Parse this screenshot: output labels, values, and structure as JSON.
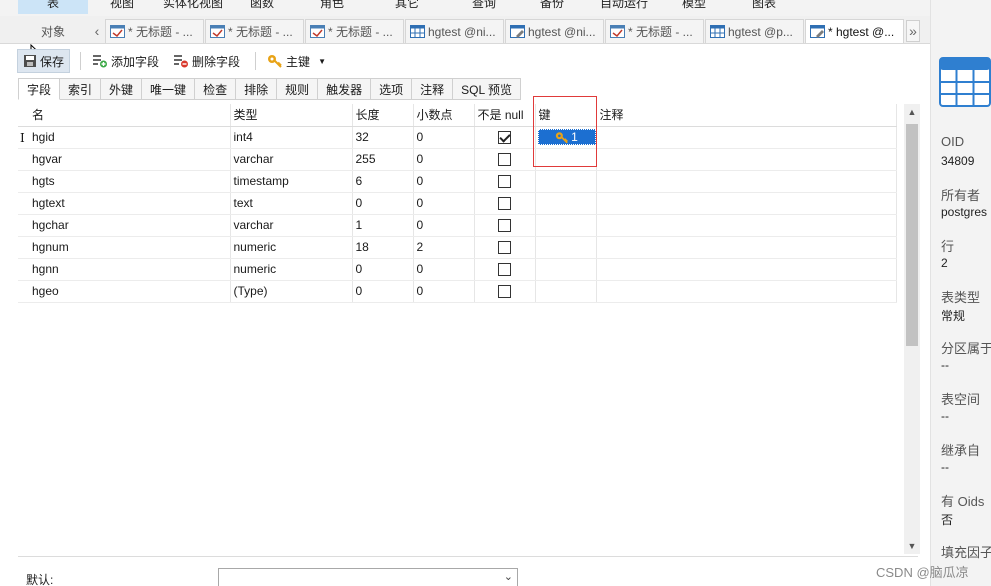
{
  "top_menu": [
    "表",
    "视图",
    "实体化视图",
    "函数",
    "角色",
    "其它",
    "查询",
    "备份",
    "自动运行",
    "模型",
    "图表"
  ],
  "tabs": {
    "objects_label": "对象",
    "items": [
      {
        "label": "* 无标题 - ...",
        "icon": "query-icon"
      },
      {
        "label": "* 无标题 - ...",
        "icon": "query-icon"
      },
      {
        "label": "* 无标题 - ...",
        "icon": "query-icon"
      },
      {
        "label": "hgtest @ni...",
        "icon": "table-icon"
      },
      {
        "label": "hgtest @ni...",
        "icon": "table-design-icon"
      },
      {
        "label": "* 无标题 - ...",
        "icon": "query-icon"
      },
      {
        "label": "hgtest @p...",
        "icon": "table-icon"
      },
      {
        "label": "* hgtest @...",
        "icon": "table-design-icon"
      }
    ]
  },
  "toolbar": {
    "save": "保存",
    "add_field": "添加字段",
    "delete_field": "删除字段",
    "primary_key": "主键"
  },
  "subtabs": [
    "字段",
    "索引",
    "外键",
    "唯一键",
    "检查",
    "排除",
    "规则",
    "触发器",
    "选项",
    "注释",
    "SQL 预览"
  ],
  "grid": {
    "columns": [
      "名",
      "类型",
      "长度",
      "小数点",
      "不是 null",
      "键",
      "注释"
    ],
    "rows": [
      {
        "name": "hgid",
        "type": "int4",
        "length": "32",
        "decimals": "0",
        "not_null": true,
        "key": "1",
        "comment": ""
      },
      {
        "name": "hgvar",
        "type": "varchar",
        "length": "255",
        "decimals": "0",
        "not_null": false,
        "key": "",
        "comment": ""
      },
      {
        "name": "hgts",
        "type": "timestamp",
        "length": "6",
        "decimals": "0",
        "not_null": false,
        "key": "",
        "comment": ""
      },
      {
        "name": "hgtext",
        "type": "text",
        "length": "0",
        "decimals": "0",
        "not_null": false,
        "key": "",
        "comment": ""
      },
      {
        "name": "hgchar",
        "type": "varchar",
        "length": "1",
        "decimals": "0",
        "not_null": false,
        "key": "",
        "comment": ""
      },
      {
        "name": "hgnum",
        "type": "numeric",
        "length": "18",
        "decimals": "2",
        "not_null": false,
        "key": "",
        "comment": ""
      },
      {
        "name": "hgnn",
        "type": "numeric",
        "length": "0",
        "decimals": "0",
        "not_null": false,
        "key": "",
        "comment": ""
      },
      {
        "name": "hgeo",
        "type": "(Type)",
        "length": "0",
        "decimals": "0",
        "not_null": false,
        "key": "",
        "comment": ""
      }
    ]
  },
  "bottom": {
    "default_label": "默认:",
    "default_value": ""
  },
  "info_panel": {
    "oid_label": "OID",
    "oid_value": "34809",
    "owner_label": "所有者",
    "owner_value": "postgres",
    "rows_label": "行",
    "rows_value": "2",
    "table_type_label": "表类型",
    "table_type_value": "常规",
    "partition_label": "分区属于",
    "partition_value": "--",
    "tablespace_label": "表空间",
    "tablespace_value": "--",
    "inherits_label": "继承自",
    "inherits_value": "--",
    "has_oids_label": "有 Oids",
    "has_oids_value": "否",
    "fillfactor_label": "填充因子"
  },
  "watermark": "CSDN @脑瓜凉",
  "colors": {
    "accent": "#1c6fd1",
    "highlight_box": "#e03a3a",
    "key_icon": "#e8a317"
  }
}
